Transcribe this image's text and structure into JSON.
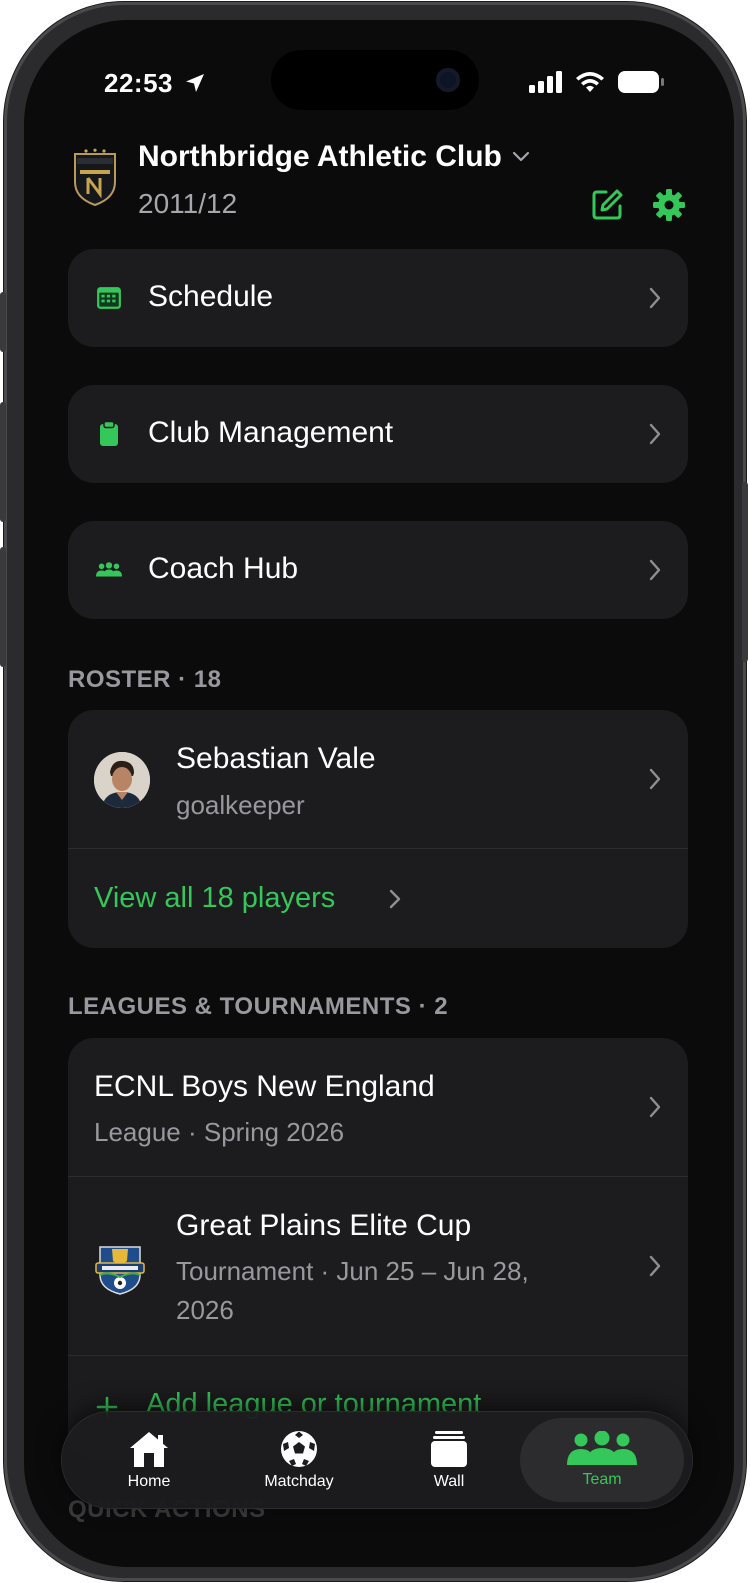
{
  "status_bar": {
    "time": "22:53"
  },
  "header": {
    "club_name": "Northbridge Athletic Club",
    "season": "2011/12"
  },
  "nav": [
    {
      "label": "Schedule",
      "icon": "calendar-icon"
    },
    {
      "label": "Club Management",
      "icon": "clipboard-icon"
    },
    {
      "label": "Coach Hub",
      "icon": "people-icon"
    }
  ],
  "roster": {
    "title": "ROSTER · 18",
    "player": {
      "name": "Sebastian Vale",
      "position": "goalkeeper"
    },
    "view_all": "View all 18 players"
  },
  "leagues": {
    "title": "LEAGUES & TOURNAMENTS · 2",
    "items": [
      {
        "name": "ECNL Boys New England",
        "detail": "League · Spring 2026"
      },
      {
        "name": "Great Plains Elite Cup",
        "detail_line1": "Tournament · Jun 25 – Jun 28,",
        "detail_line2": "2026"
      }
    ],
    "add_label": "Add league or tournament"
  },
  "quick_actions_title": "QUICK ACTIONS",
  "tabbar": {
    "tabs": [
      {
        "label": "Home",
        "icon": "home-icon"
      },
      {
        "label": "Matchday",
        "icon": "soccer-ball-icon"
      },
      {
        "label": "Wall",
        "icon": "wall-icon"
      },
      {
        "label": "Team",
        "icon": "team-icon",
        "active": true
      }
    ]
  },
  "colors": {
    "accent": "#34c759",
    "background": "#0b0b0c",
    "card": "#1c1c1e",
    "secondary_text": "#98989e"
  }
}
